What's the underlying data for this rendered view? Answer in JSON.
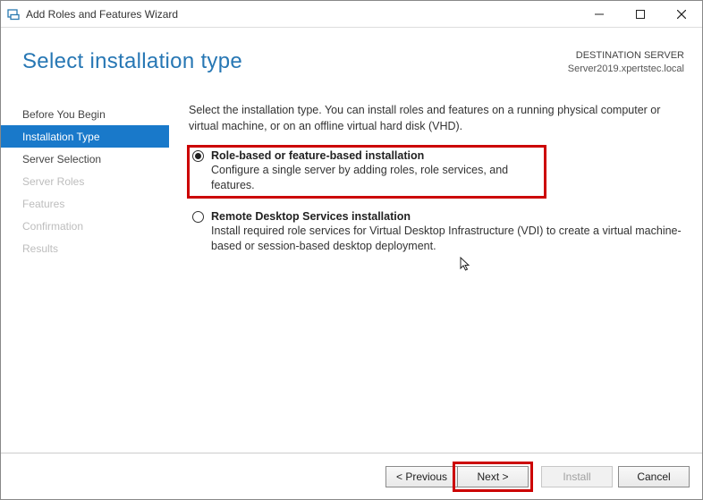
{
  "window": {
    "title": "Add Roles and Features Wizard"
  },
  "header": {
    "page_title": "Select installation type",
    "dest_label": "DESTINATION SERVER",
    "dest_name": "Server2019.xpertstec.local"
  },
  "sidebar": {
    "items": [
      {
        "label": "Before You Begin",
        "state": "normal"
      },
      {
        "label": "Installation Type",
        "state": "selected"
      },
      {
        "label": "Server Selection",
        "state": "normal"
      },
      {
        "label": "Server Roles",
        "state": "disabled"
      },
      {
        "label": "Features",
        "state": "disabled"
      },
      {
        "label": "Confirmation",
        "state": "disabled"
      },
      {
        "label": "Results",
        "state": "disabled"
      }
    ]
  },
  "content": {
    "intro": "Select the installation type. You can install roles and features on a running physical computer or virtual machine, or on an offline virtual hard disk (VHD).",
    "options": [
      {
        "title": "Role-based or feature-based installation",
        "desc": "Configure a single server by adding roles, role services, and features.",
        "checked": true,
        "highlight": true
      },
      {
        "title": "Remote Desktop Services installation",
        "desc": "Install required role services for Virtual Desktop Infrastructure (VDI) to create a virtual machine-based or session-based desktop deployment.",
        "checked": false,
        "highlight": false
      }
    ]
  },
  "footer": {
    "previous": "< Previous",
    "next": "Next >",
    "install": "Install",
    "cancel": "Cancel"
  }
}
